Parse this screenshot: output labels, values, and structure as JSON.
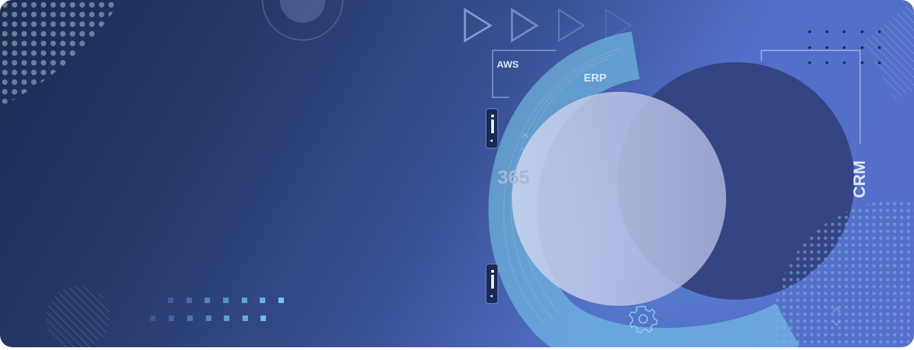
{
  "banner": {
    "labels": {
      "aws": "AWS",
      "erp": "ERP",
      "num365": "365",
      "crm": "CRM"
    },
    "icons": [
      "play-triangle-icon",
      "gear-icon",
      "info-icon",
      "chevron-up-down-icon"
    ],
    "colors": {
      "deep_navy": "#1e2b52",
      "royal_blue": "#5170c8",
      "circle_dark": "#354583",
      "circle_light": "#a9b3dd",
      "cyan_ring": "#7ed1ee",
      "square_accent": "#6fc6f5"
    }
  }
}
